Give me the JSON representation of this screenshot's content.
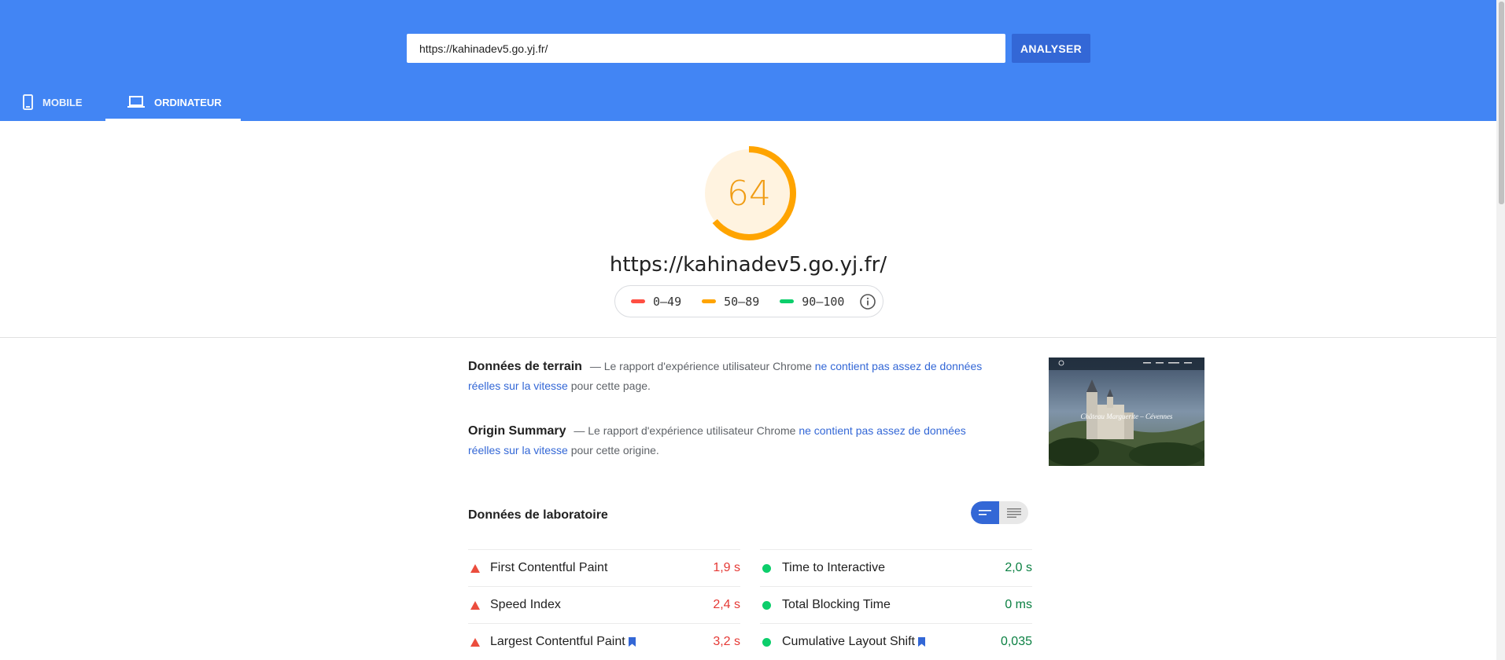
{
  "search": {
    "value": "https://kahinadev5.go.yj.fr/",
    "button_label": "ANALYSER"
  },
  "tabs": [
    {
      "label": "MOBILE",
      "icon": "smartphone-icon",
      "active": false
    },
    {
      "label": "ORDINATEUR",
      "icon": "laptop-icon",
      "active": true
    }
  ],
  "score": {
    "value": "64",
    "fraction": 0.64,
    "color": "#f09c14",
    "url": "https://kahinadev5.go.yj.fr/"
  },
  "legend": [
    {
      "range": "0–49",
      "color": "#ff4e42"
    },
    {
      "range": "50–89",
      "color": "#ffa400"
    },
    {
      "range": "90–100",
      "color": "#0cce6b"
    }
  ],
  "field_data": {
    "title": "Données de terrain",
    "prefix": " — Le rapport d'expérience utilisateur Chrome ",
    "link": "ne contient pas assez de données réelles sur la vitesse",
    "suffix": " pour cette page."
  },
  "origin_summary": {
    "title": "Origin Summary",
    "prefix": " — Le rapport d'expérience utilisateur Chrome ",
    "link": "ne contient pas assez de données réelles sur la vitesse",
    "suffix": " pour cette origine."
  },
  "thumbnail": {
    "headline": "Château Marguerite – Cévennes"
  },
  "lab": {
    "title": "Données de laboratoire",
    "metrics_left": [
      {
        "label": "First Contentful Paint",
        "value": "1,9 s",
        "status": "fail",
        "bookmark": false
      },
      {
        "label": "Speed Index",
        "value": "2,4 s",
        "status": "fail",
        "bookmark": false
      },
      {
        "label": "Largest Contentful Paint",
        "value": "3,2 s",
        "status": "fail",
        "bookmark": true
      }
    ],
    "metrics_right": [
      {
        "label": "Time to Interactive",
        "value": "2,0 s",
        "status": "pass",
        "bookmark": false
      },
      {
        "label": "Total Blocking Time",
        "value": "0 ms",
        "status": "pass",
        "bookmark": false
      },
      {
        "label": "Cumulative Layout Shift",
        "value": "0,035",
        "status": "pass",
        "bookmark": true
      }
    ]
  }
}
